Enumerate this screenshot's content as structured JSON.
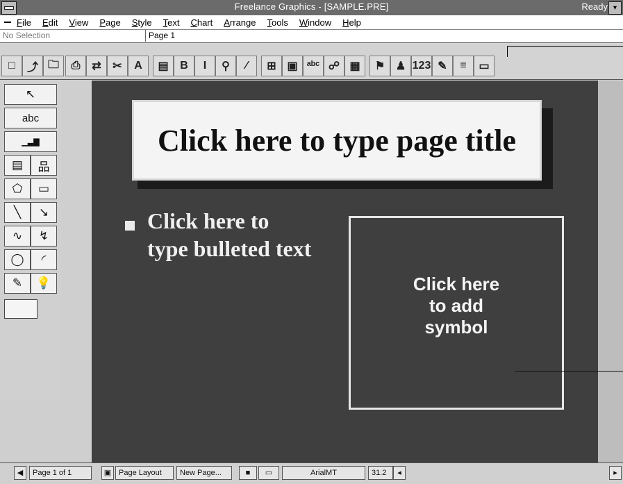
{
  "window": {
    "title": "Freelance Graphics - [SAMPLE.PRE]",
    "status_right": "Ready"
  },
  "menu": [
    "File",
    "Edit",
    "View",
    "Page",
    "Style",
    "Text",
    "Chart",
    "Arrange",
    "Tools",
    "Window",
    "Help"
  ],
  "editline": {
    "selection": "No Selection",
    "page": "Page 1"
  },
  "toolbar": {
    "buttons": [
      {
        "name": "new-icon",
        "glyph": "□"
      },
      {
        "name": "open-icon",
        "glyph": "⤴"
      },
      {
        "name": "folder-icon",
        "glyph": "🗀"
      },
      {
        "name": "print-icon",
        "glyph": "⎙"
      },
      {
        "name": "replace-icon",
        "glyph": "⇄"
      },
      {
        "name": "cut-icon",
        "glyph": "✂"
      },
      {
        "name": "font-size-icon",
        "glyph": "A"
      },
      {
        "name": "paste-icon",
        "glyph": "▤"
      },
      {
        "name": "bold-icon",
        "glyph": "B"
      },
      {
        "name": "italic-icon",
        "glyph": "I"
      },
      {
        "name": "zoom-icon",
        "glyph": "⚲"
      },
      {
        "name": "line-icon",
        "glyph": "⁄"
      },
      {
        "name": "screen-show-icon",
        "glyph": "⊞"
      },
      {
        "name": "abc-icon",
        "glyph": "▣"
      },
      {
        "name": "spell-icon",
        "glyph": "ᵃᵇᶜ"
      },
      {
        "name": "wand-icon",
        "glyph": "☍"
      },
      {
        "name": "group-icon",
        "glyph": "▦"
      },
      {
        "name": "symbol-tool-icon",
        "glyph": "⚑"
      },
      {
        "name": "add-symbol-icon",
        "glyph": "♟"
      },
      {
        "name": "numbers-icon",
        "glyph": "123"
      },
      {
        "name": "chart-icon",
        "glyph": "✎"
      },
      {
        "name": "table-icon",
        "glyph": "≡"
      },
      {
        "name": "page-icon",
        "glyph": "▭"
      }
    ]
  },
  "toolbox": {
    "tools": [
      {
        "name": "pointer-tool",
        "glyph": "↖",
        "full": true
      },
      {
        "name": "text-tool",
        "glyph": "abc",
        "full": true
      },
      {
        "name": "chart-tool",
        "glyph": "▁▃▇",
        "full": true
      },
      {
        "name": "table-tool",
        "glyph": "▤"
      },
      {
        "name": "org-chart-tool",
        "glyph": "品"
      },
      {
        "name": "polygon-tool",
        "glyph": "⬠"
      },
      {
        "name": "rectangle-tool",
        "glyph": "▭"
      },
      {
        "name": "line-tool",
        "glyph": "╲"
      },
      {
        "name": "arrow-tool",
        "glyph": "↘"
      },
      {
        "name": "curve-tool",
        "glyph": "∿"
      },
      {
        "name": "polyline-tool",
        "glyph": "↯"
      },
      {
        "name": "ellipse-tool",
        "glyph": "◯"
      },
      {
        "name": "arc-tool",
        "glyph": "◜"
      },
      {
        "name": "freehand-tool",
        "glyph": "✎"
      },
      {
        "name": "symbol-tool",
        "glyph": "💡"
      }
    ]
  },
  "slide": {
    "title": "Click here to type page title",
    "bullet": "Click here to\ntype bulleted text",
    "symbol": "Click here\nto add\nsymbol"
  },
  "statusbar": {
    "page": "Page 1 of 1",
    "view": "Page Layout",
    "new_page": "New Page...",
    "font": "ArialMT",
    "size": "31.2"
  },
  "colors": {
    "slide_bg": "#3f3f3f",
    "title_box_bg": "#f4f4f4",
    "titlebar": "#6b6b6b"
  }
}
